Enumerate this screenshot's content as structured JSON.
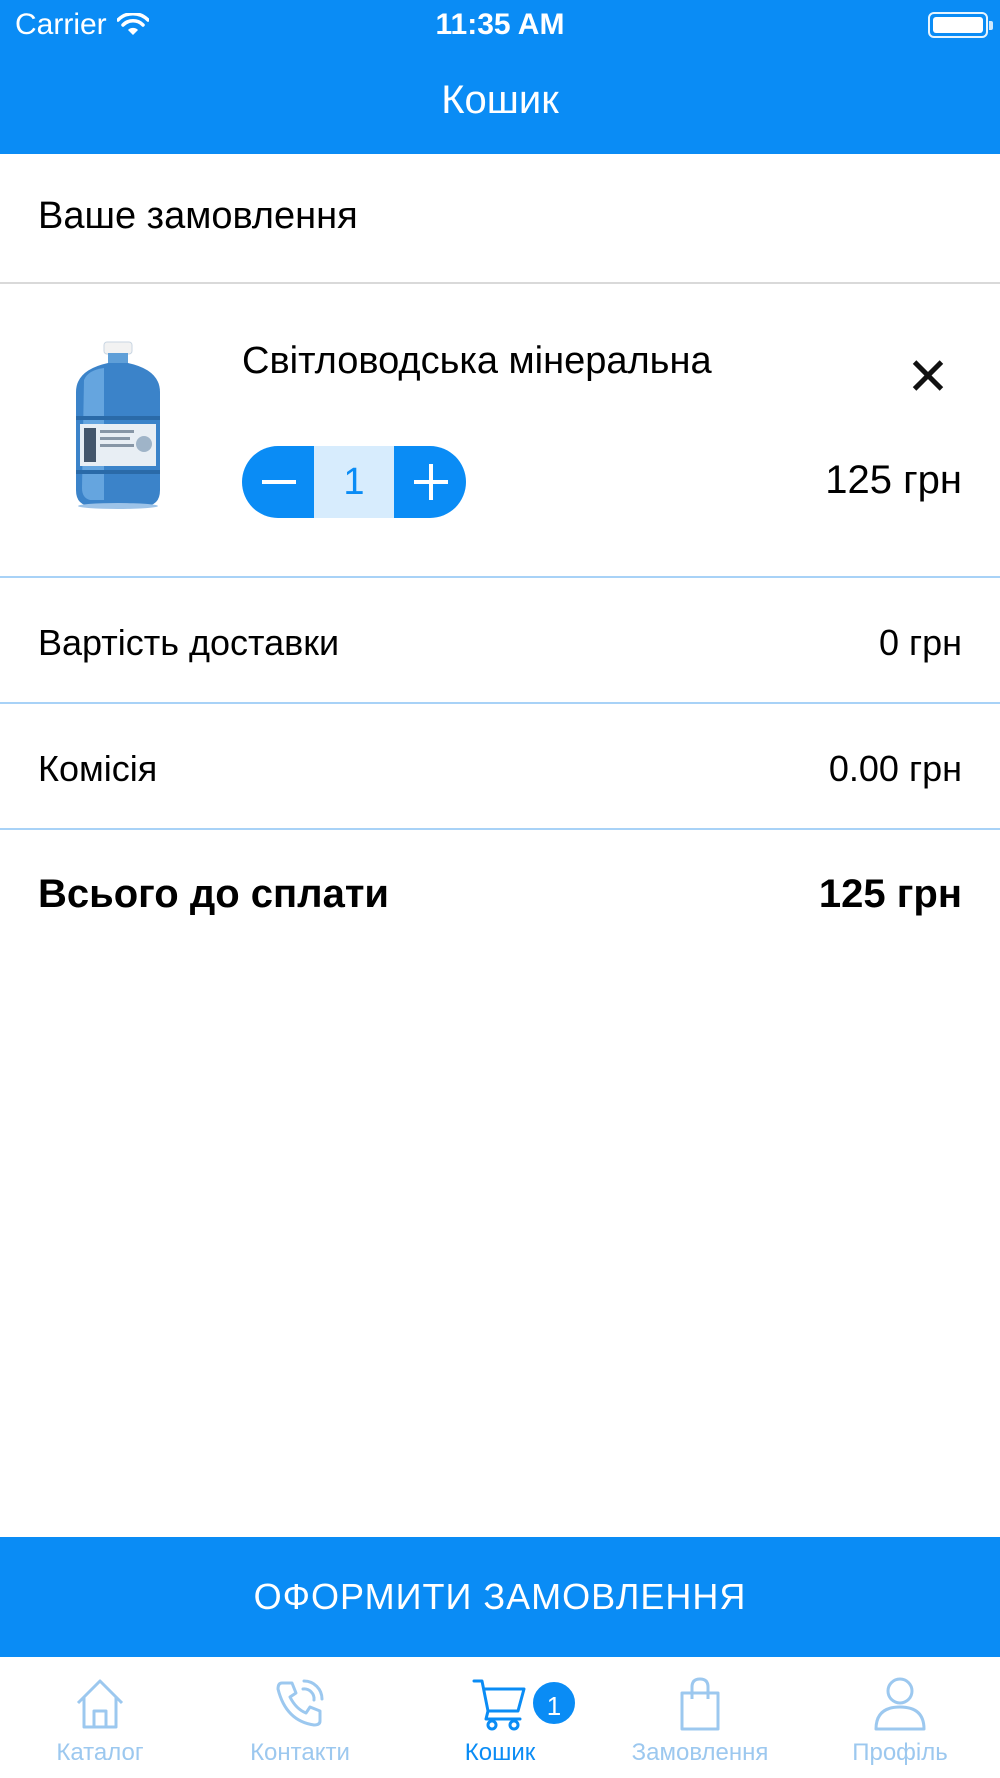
{
  "status_bar": {
    "carrier": "Carrier",
    "time": "11:35 AM"
  },
  "nav": {
    "title": "Кошик"
  },
  "order": {
    "section_title": "Ваше замовлення",
    "item": {
      "name": "Світловодська мінеральна",
      "quantity": "1",
      "price": "125 грн",
      "image": "water-bottle-image"
    }
  },
  "summary": {
    "delivery_label": "Вартість доставки",
    "delivery_value": "0 грн",
    "commission_label": "Комісія",
    "commission_value": "0.00 грн",
    "total_label": "Всього до сплати",
    "total_value": "125 грн"
  },
  "checkout_label": "ОФОРМИТИ ЗАМОВЛЕННЯ",
  "tabs": [
    {
      "label": "Каталог",
      "icon": "home-icon"
    },
    {
      "label": "Контакти",
      "icon": "phone-icon"
    },
    {
      "label": "Кошик",
      "icon": "cart-icon",
      "badge": "1"
    },
    {
      "label": "Замовлення",
      "icon": "shopping-bag-icon"
    },
    {
      "label": "Профіль",
      "icon": "user-icon"
    }
  ],
  "colors": {
    "accent": "#0a8cf5",
    "tab_inactive": "#9cc8ef",
    "divider": "#a8d2f7"
  }
}
